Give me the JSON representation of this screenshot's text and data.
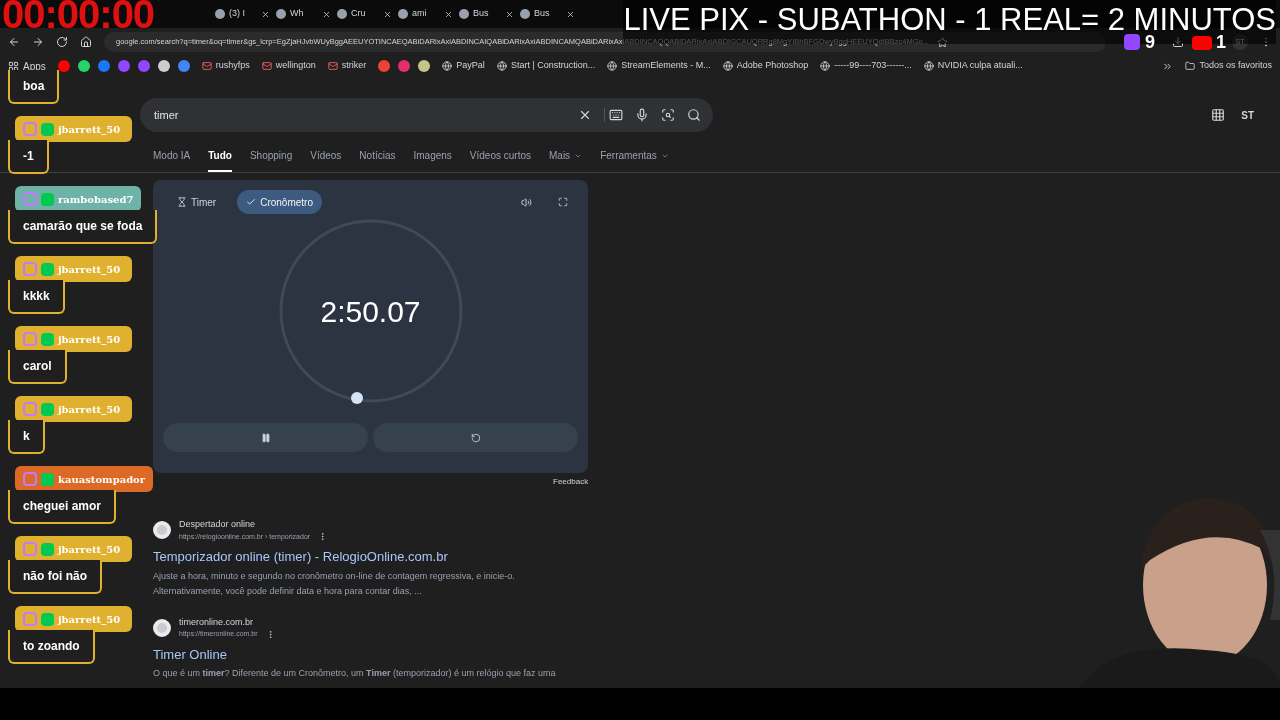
{
  "overlay": {
    "clock": "00:00:00",
    "title": "LIVE PIX - SUBATHON - 1 REAL= 2 MINUTOS",
    "twitch_count": "9",
    "youtube_count": "1"
  },
  "browser": {
    "tabs": [
      "(3) I",
      "Wh",
      "Cru",
      "ami",
      "Bus",
      "Bus"
    ],
    "url": "google.com/search?q=timer&oq=timer&gs_lcrp=EgZjaHJvbWUyBggAEEUYOTINCAEQABiDARixAxiABDINCAIQABiDARixAxiABDINCAMQABiDARixAxiABDINCAQQABiDARixAxiABDIGCAUQRRg8MgYIBhBFGDwyBggHEEUYQdIBBzc4MGo...",
    "profile": "ST",
    "bookmarks": [
      {
        "kind": "apps",
        "label": "Apps"
      },
      {
        "kind": "icons"
      },
      {
        "kind": "mail",
        "label": "rushyfps"
      },
      {
        "kind": "mail",
        "label": "wellington"
      },
      {
        "kind": "mail",
        "label": "striker"
      },
      {
        "kind": "icons2"
      },
      {
        "kind": "site",
        "label": "PayPal"
      },
      {
        "kind": "site",
        "label": "Start | Construction..."
      },
      {
        "kind": "site",
        "label": "StreamElements - M..."
      },
      {
        "kind": "site",
        "label": "Adobe Photoshop"
      },
      {
        "kind": "site",
        "label": "-----99----703------..."
      },
      {
        "kind": "site",
        "label": "NVIDIA culpa atuali..."
      }
    ],
    "all_bookmarks": "Todos os favoritos"
  },
  "search": {
    "query": "timer",
    "profile": "ST"
  },
  "nav_tabs": [
    {
      "label": "Modo IA",
      "selected": false,
      "menu": false
    },
    {
      "label": "Tudo",
      "selected": true,
      "menu": false
    },
    {
      "label": "Shopping",
      "selected": false,
      "menu": false
    },
    {
      "label": "Vídeos",
      "selected": false,
      "menu": false
    },
    {
      "label": "Notícias",
      "selected": false,
      "menu": false
    },
    {
      "label": "Imagens",
      "selected": false,
      "menu": false
    },
    {
      "label": "Vídeos curtos",
      "selected": false,
      "menu": false
    },
    {
      "label": "Mais",
      "selected": false,
      "menu": true
    },
    {
      "label": "Ferramentas",
      "selected": false,
      "menu": true
    }
  ],
  "stopwatch": {
    "modes": [
      {
        "label": "Timer",
        "selected": false
      },
      {
        "label": "Cronômetro",
        "selected": true
      }
    ],
    "time": "2:50.07",
    "feedback": "Feedback"
  },
  "results": [
    {
      "site": "Despertador online",
      "url": "https://relogioonline.com.br › temporizador",
      "title": "Temporizador online (timer) - RelogioOnline.com.br",
      "snippet": "Ajuste a hora, minuto e segundo no cronômetro on-line de contagem regressiva, e inicie-o. Alternativamente, você pode definir data e hora para contar dias, ..."
    },
    {
      "site": "timeronline.com.br",
      "url": "https://timeronline.com.br",
      "title": "Timer Online",
      "snippet": "O que é um **timer**? Diferente de um Cronômetro, um **Timer** (temporizador) é um relógio que faz uma"
    }
  ],
  "chat": [
    {
      "text": "boa"
    },
    {
      "user": "jbarrett_50",
      "text": "-1",
      "color": "#e0b12e"
    },
    {
      "user": "rambobased7",
      "text": "camarão que se foda",
      "color": "#6fb3a8"
    },
    {
      "user": "jbarrett_50",
      "text": "kkkk",
      "color": "#e0b12e"
    },
    {
      "user": "jbarrett_50",
      "text": "carol",
      "color": "#e0b12e"
    },
    {
      "user": "jbarrett_50",
      "text": "k",
      "color": "#e0b12e"
    },
    {
      "user": "kauastompador",
      "text": "cheguei amor",
      "color": "#dc6a26"
    },
    {
      "user": "jbarrett_50",
      "text": "não foi não",
      "color": "#e0b12e"
    },
    {
      "user": "jbarrett_50",
      "text": "to zoando",
      "color": "#e0b12e"
    }
  ]
}
